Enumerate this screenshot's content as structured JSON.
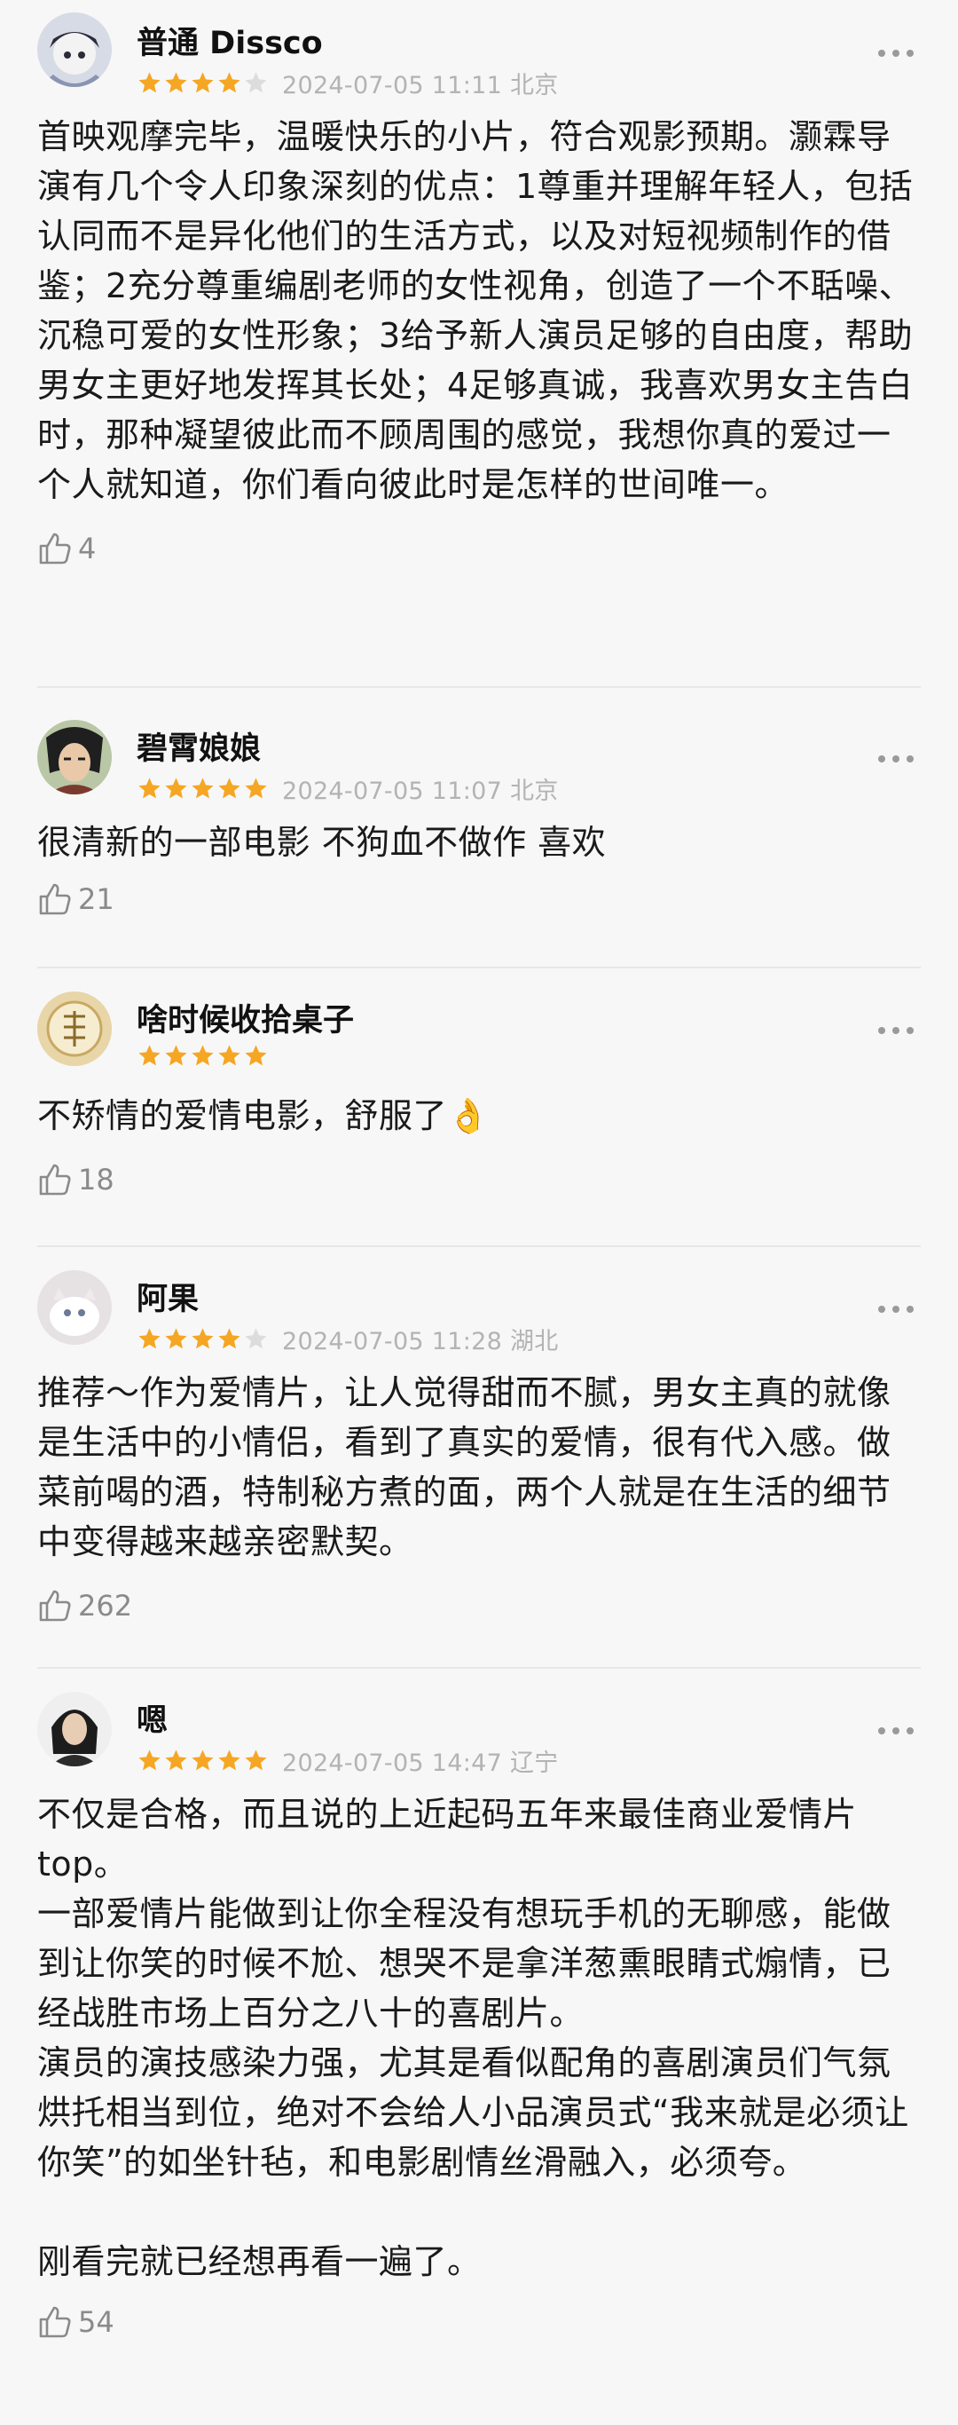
{
  "reviews": [
    {
      "user": "普通 Dissco",
      "rating": 4,
      "meta": "2024-07-05 11:11 北京",
      "text": "首映观摩完毕，温暖快乐的小片，符合观影预期。灏霖导演有几个令人印象深刻的优点：1尊重并理解年轻人，包括认同而不是异化他们的生活方式，以及对短视频制作的借鉴；2充分尊重编剧老师的女性视角，创造了一个不聒噪、沉稳可爱的女性形象；3给予新人演员足够的自由度，帮助男女主更好地发挥其长处；4足够真诚，我喜欢男女主告白时，那种凝望彼此而不顾周围的感觉，我想你真的爱过一个人就知道，你们看向彼此时是怎样的世间唯一。",
      "likes": "4"
    },
    {
      "user": "碧霄娘娘",
      "rating": 5,
      "meta": "2024-07-05 11:07 北京",
      "text": "很清新的一部电影 不狗血不做作 喜欢",
      "likes": "21"
    },
    {
      "user": "啥时候收拾桌子",
      "rating": 5,
      "meta": "",
      "text": "不矫情的爱情电影，舒服了👌",
      "likes": "18"
    },
    {
      "user": "阿果",
      "rating": 4,
      "meta": "2024-07-05 11:28 湖北",
      "text": "推荐～作为爱情片，让人觉得甜而不腻，男女主真的就像是生活中的小情侣，看到了真实的爱情，很有代入感。做菜前喝的酒，特制秘方煮的面，两个人就是在生活的细节中变得越来越亲密默契。",
      "likes": "262"
    },
    {
      "user": "嗯",
      "rating": 5,
      "meta": "2024-07-05 14:47 辽宁",
      "text": "不仅是合格，而且说的上近起码五年来最佳商业爱情片top。\n一部爱情片能做到让你全程没有想玩手机的无聊感，能做到让你笑的时候不尬、想哭不是拿洋葱熏眼睛式煽情，已经战胜市场上百分之八十的喜剧片。\n演员的演技感染力强，尤其是看似配角的喜剧演员们气氛烘托相当到位，绝对不会给人小品演员式“我来就是必须让你笑”的如坐针毡，和电影剧情丝滑融入，必须夸。\n\n刚看完就已经想再看一遍了。",
      "likes": "54"
    }
  ],
  "icons": {
    "more": "more-dots-icon",
    "like": "thumbs-up-icon",
    "star": "star-icon"
  },
  "colors": {
    "star_filled": "#f5a623",
    "star_empty": "#dcdcdc",
    "meta_text": "#b3b3b3"
  }
}
